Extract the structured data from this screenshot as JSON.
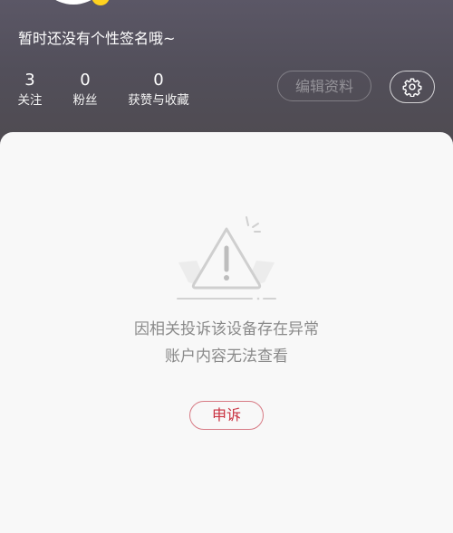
{
  "profile": {
    "signature": "暂时还没有个性签名哦~",
    "stats": [
      {
        "value": "3",
        "label": "关注"
      },
      {
        "value": "0",
        "label": "粉丝"
      },
      {
        "value": "0",
        "label": "获赞与收藏"
      }
    ],
    "edit_button": "编辑资料",
    "settings_icon": "gear-icon"
  },
  "notice": {
    "line1": "因相关投诉该设备存在异常",
    "line2": "账户内容无法查看",
    "appeal_button": "申诉",
    "warning_icon": "warning-triangle-icon"
  },
  "colors": {
    "header_bg": "#524f5a",
    "appeal_text": "#c9303f",
    "appeal_border": "#d77a84",
    "message_text": "#8a8a8a"
  }
}
